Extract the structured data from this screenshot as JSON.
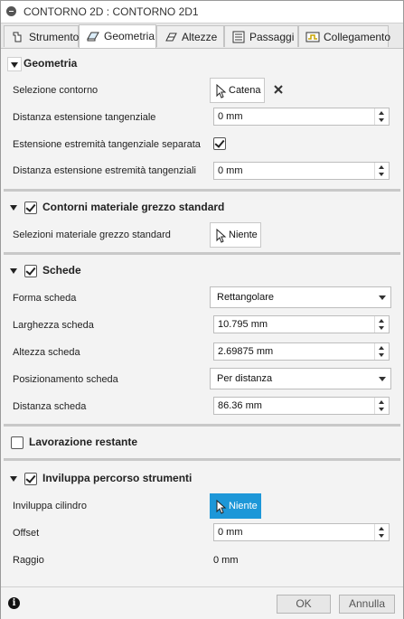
{
  "window": {
    "title": "CONTORNO 2D : CONTORNO 2D1"
  },
  "tabs": [
    {
      "label": "Strumento",
      "icon": "tool-icon"
    },
    {
      "label": "Geometria",
      "icon": "geometry-icon"
    },
    {
      "label": "Altezze",
      "icon": "heights-icon"
    },
    {
      "label": "Passaggi",
      "icon": "passes-icon"
    },
    {
      "label": "Collegamento",
      "icon": "linking-icon"
    }
  ],
  "active_tab": "Geometria",
  "geometria": {
    "title": "Geometria",
    "selezione_contorno_label": "Selezione contorno",
    "selezione_contorno_button": "Catena",
    "dist_est_tangenziale_label": "Distanza estensione tangenziale",
    "dist_est_tangenziale_value": "0 mm",
    "est_estremita_separata_label": "Estensione estremità tangenziale separata",
    "est_estremita_separata_checked": true,
    "dist_est_estremita_label": "Distanza estensione estremità tangenziali",
    "dist_est_estremita_value": "0 mm"
  },
  "contorni_grezzo": {
    "title": "Contorni materiale grezzo standard",
    "checked": true,
    "selezioni_label": "Selezioni materiale grezzo standard",
    "selezioni_button": "Niente"
  },
  "schede": {
    "title": "Schede",
    "checked": true,
    "forma_label": "Forma scheda",
    "forma_value": "Rettangolare",
    "larghezza_label": "Larghezza scheda",
    "larghezza_value": "10.795 mm",
    "altezza_label": "Altezza scheda",
    "altezza_value": "2.69875 mm",
    "posizionamento_label": "Posizionamento scheda",
    "posizionamento_value": "Per distanza",
    "distanza_label": "Distanza scheda",
    "distanza_value": "86.36 mm"
  },
  "lavorazione_restante": {
    "title": "Lavorazione restante",
    "checked": false
  },
  "inviluppa": {
    "title": "Inviluppa percorso strumenti",
    "checked": true,
    "cilindro_label": "Inviluppa cilindro",
    "cilindro_button": "Niente",
    "offset_label": "Offset",
    "offset_value": "0 mm",
    "raggio_label": "Raggio",
    "raggio_value": "0 mm"
  },
  "footer": {
    "ok_label": "OK",
    "cancel_label": "Annulla"
  },
  "colors": {
    "accent": "#1d97d8"
  }
}
